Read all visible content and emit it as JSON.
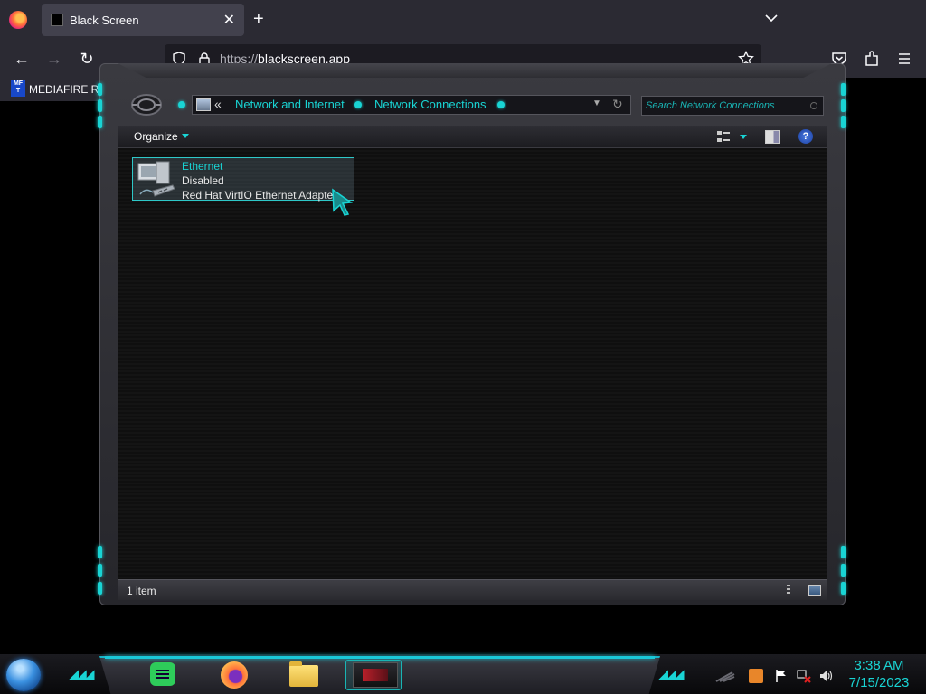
{
  "browser": {
    "tab_title": "Black Screen",
    "url_protocol": "https://",
    "url_host": "blackscreen.app",
    "bookmark_icon_text": "MF T",
    "bookmark_label": "MEDIAFIRE RO"
  },
  "explorer": {
    "breadcrumb_overflow": "«",
    "breadcrumbs": [
      "Network and Internet",
      "Network Connections"
    ],
    "search_placeholder": "Search Network Connections",
    "organize_label": "Organize",
    "help_glyph": "?",
    "items": [
      {
        "name": "Ethernet",
        "status": "Disabled",
        "device": "Red Hat VirtIO Ethernet Adapter"
      }
    ],
    "status_count": "1 item"
  },
  "taskbar": {
    "apps": [
      "sticky-notes",
      "firefox",
      "file-explorer",
      "active-window"
    ],
    "clock_time": "3:38 AM",
    "clock_date": "7/15/2023"
  },
  "colors": {
    "accent": "#19d4d4",
    "browser_bg": "#2b2a33"
  }
}
